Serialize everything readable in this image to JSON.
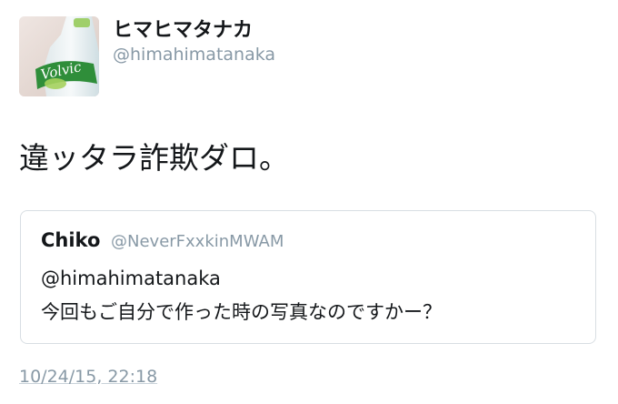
{
  "author": {
    "display_name": "ヒマヒマタナカ",
    "handle": "@himahimatanaka",
    "avatar_brand_text": "Volvic"
  },
  "tweet": {
    "text": "違ッタラ詐欺ダロ。",
    "timestamp": "10/24/15, 22:18"
  },
  "quoted_tweet": {
    "display_name": "Chiko",
    "handle": "@NeverFxxkinMWAM",
    "text_line1": "@himahimatanaka",
    "text_line2": "今回もご自分で作った時の写真なのですかー？"
  },
  "colors": {
    "text_primary": "#14171a",
    "text_secondary": "#8899a6",
    "border": "#d8dee3"
  }
}
